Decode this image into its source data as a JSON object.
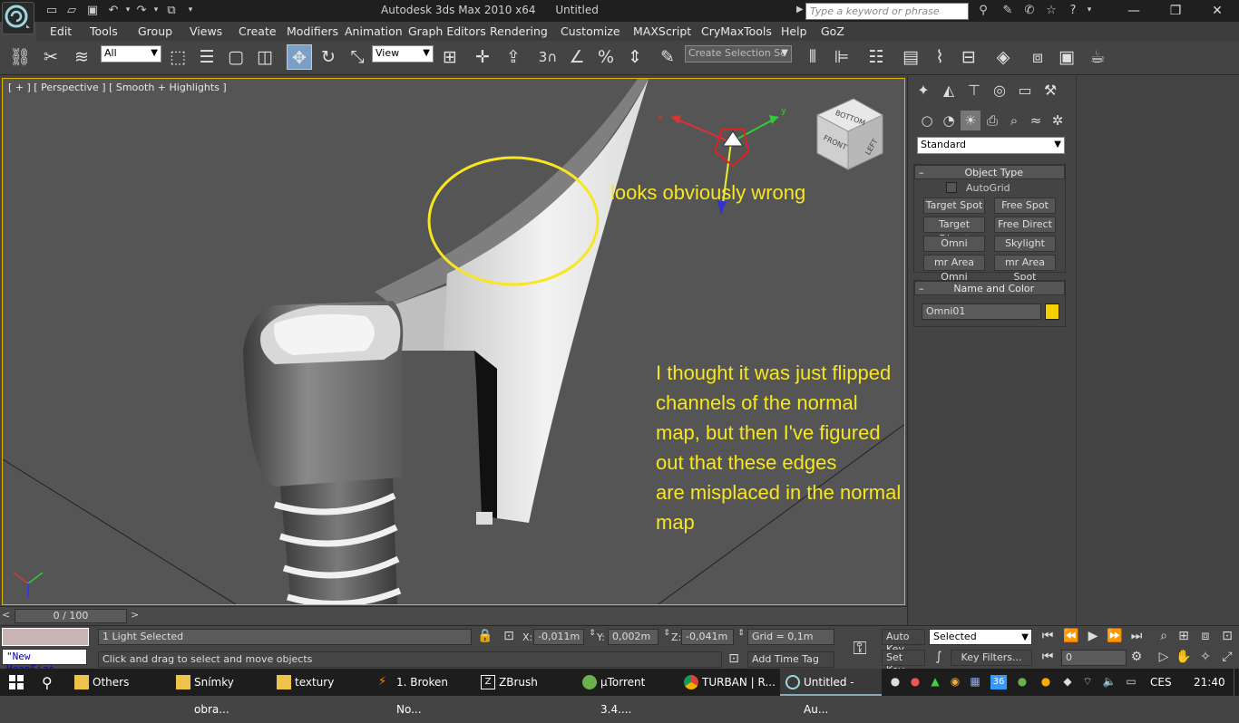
{
  "window": {
    "title": "Autodesk 3ds Max  2010 x64",
    "file": "Untitled",
    "search_placeholder": "Type a keyword or phrase"
  },
  "menu": [
    "Edit",
    "Tools",
    "Group",
    "Views",
    "Create",
    "Modifiers",
    "Animation",
    "Graph Editors",
    "Rendering",
    "Customize",
    "MAXScript",
    "CryMaxTools",
    "Help",
    "GoZ"
  ],
  "toolbar": {
    "selection_filter": "All",
    "reference_coord": "View",
    "snap_label": "3",
    "named_selection_placeholder": "Create Selection Se"
  },
  "viewport": {
    "label": "[ + ] [ Perspective ] [ Smooth + Highlights ]",
    "annotation_short": "looks obviously wrong",
    "annotation_long_1": "I thought it was just flipped channels of the normal",
    "annotation_long_2": "map, but then I've figured out that these edges",
    "annotation_long_3": "are misplaced in the normal map",
    "viewcube": {
      "top": "BOTTOM",
      "front": "FRONT",
      "left": "LEFT"
    },
    "gizmo_axes": {
      "x": "x",
      "y": "y",
      "z": "z"
    },
    "highlight_color": "#f7e620"
  },
  "command_panel": {
    "category": "Standard",
    "object_type_header": "Object Type",
    "autogrid_label": "AutoGrid",
    "buttons": [
      [
        "Target Spot",
        "Free Spot"
      ],
      [
        "Target Direct",
        "Free Direct"
      ],
      [
        "Omni",
        "Skylight"
      ],
      [
        "mr Area Omni",
        "mr Area Spot"
      ]
    ],
    "name_color_header": "Name and Color",
    "object_name": "Omni01",
    "object_color": "#f7d000"
  },
  "timeline": {
    "frame_display": "0 / 100"
  },
  "status": {
    "selection_count": "1 Light Selected",
    "prompt": "Click and drag to select and move objects",
    "listener": "\"New HeapSizè",
    "x_label": "X:",
    "x_value": "-0,011m",
    "y_label": "Y:",
    "y_value": "0,002m",
    "z_label": "Z:",
    "z_value": "-0,041m",
    "grid": "Grid = 0,1m",
    "add_time_tag": "Add Time Tag",
    "auto_key": "Auto Key",
    "set_key": "Set Key",
    "key_mode": "Selected",
    "key_filters": "Key Filters...",
    "frame_field": "0"
  },
  "taskbar": {
    "tasks": [
      {
        "label": "Others",
        "icon": "folder-icon"
      },
      {
        "label": "Snímky obra...",
        "icon": "folder-icon"
      },
      {
        "label": "textury",
        "icon": "folder-icon"
      },
      {
        "label": "1. Broken No...",
        "icon": "app-icon"
      },
      {
        "label": "ZBrush",
        "icon": "zbrush-icon"
      },
      {
        "label": "µTorrent 3.4....",
        "icon": "utorrent-icon"
      },
      {
        "label": "TURBAN | R...",
        "icon": "chrome-icon"
      },
      {
        "label": "Untitled - Au...",
        "icon": "max-icon"
      }
    ],
    "tray_badge": "36",
    "language": "CES",
    "clock": "21:40"
  }
}
